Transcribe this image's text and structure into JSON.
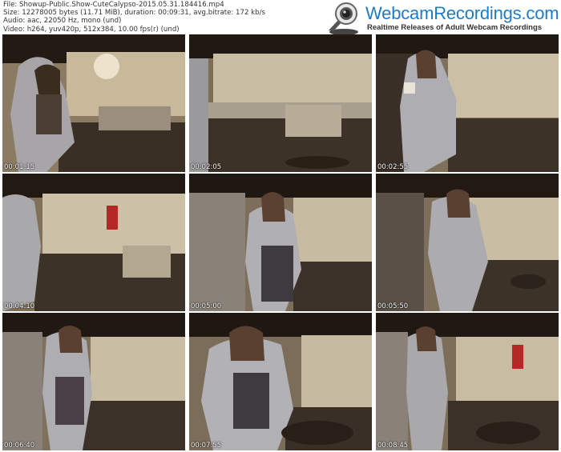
{
  "meta": {
    "file": "File: Showup-Public.Show-CuteCalypso-2015.05.31.184416.mp4",
    "size": "Size: 12278005 bytes (11.71 MiB), duration: 00:09:31, avg.bitrate: 172 kb/s",
    "audio": "Audio: aac, 22050 Hz, mono (und)",
    "video": "Video: h264, yuv420p, 512x384, 10.00 fps(r) (und)"
  },
  "logo": {
    "name": "WebcamRecordings.com",
    "tagline": "Realtime Releases of Adult Webcam Recordings"
  },
  "thumbnails": [
    {
      "timestamp": "00:01:15"
    },
    {
      "timestamp": "00:02:05"
    },
    {
      "timestamp": "00:02:55"
    },
    {
      "timestamp": "00:04:10"
    },
    {
      "timestamp": "00:05:00"
    },
    {
      "timestamp": "00:05:50"
    },
    {
      "timestamp": "00:06:40"
    },
    {
      "timestamp": "00:07:55"
    },
    {
      "timestamp": "00:08:45"
    }
  ]
}
